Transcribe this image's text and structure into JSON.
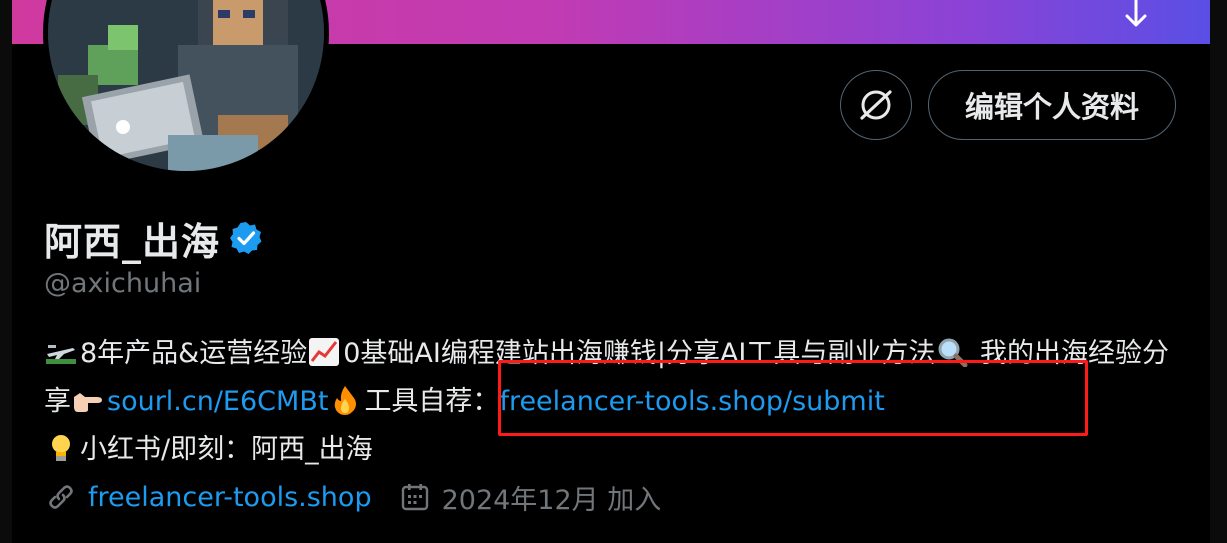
{
  "colors": {
    "background": "#000000",
    "text_primary": "#e7e9ea",
    "text_secondary": "#71767b",
    "link": "#1d9bf0",
    "highlight_box": "#ff1a1a",
    "banner_start": "#d03a9f",
    "banner_end": "#5a4fe5"
  },
  "profile": {
    "display_name": "阿西_出海",
    "handle": "@axichuhai",
    "verified": true,
    "edit_button_label": "编辑个人资料",
    "grok_icon": "slashed-circle-icon"
  },
  "bio": {
    "seg1_icon": "airplane-emoji",
    "seg1": "8年产品&运营经验",
    "seg2_icon": "chart-increasing-emoji",
    "seg2": "0基础AI编程建站出海赚钱|分享AI工具与副业方法",
    "seg3_icon": "magnifying-glass-emoji",
    "seg3": " 我的出海经验分享",
    "seg4_icon": "pointing-right-emoji",
    "link1": "sourl.cn/E6CMBt",
    "seg5_icon": "fire-emoji",
    "seg5": "工具自荐：",
    "link2": "freelancer-tools.shop/submit",
    "seg6_icon": "light-bulb-emoji",
    "seg6": "小红书/即刻：阿西_出海"
  },
  "meta": {
    "website_icon": "link-icon",
    "website": "freelancer-tools.shop",
    "calendar_icon": "calendar-icon",
    "joined": "2024年12月 加入"
  }
}
